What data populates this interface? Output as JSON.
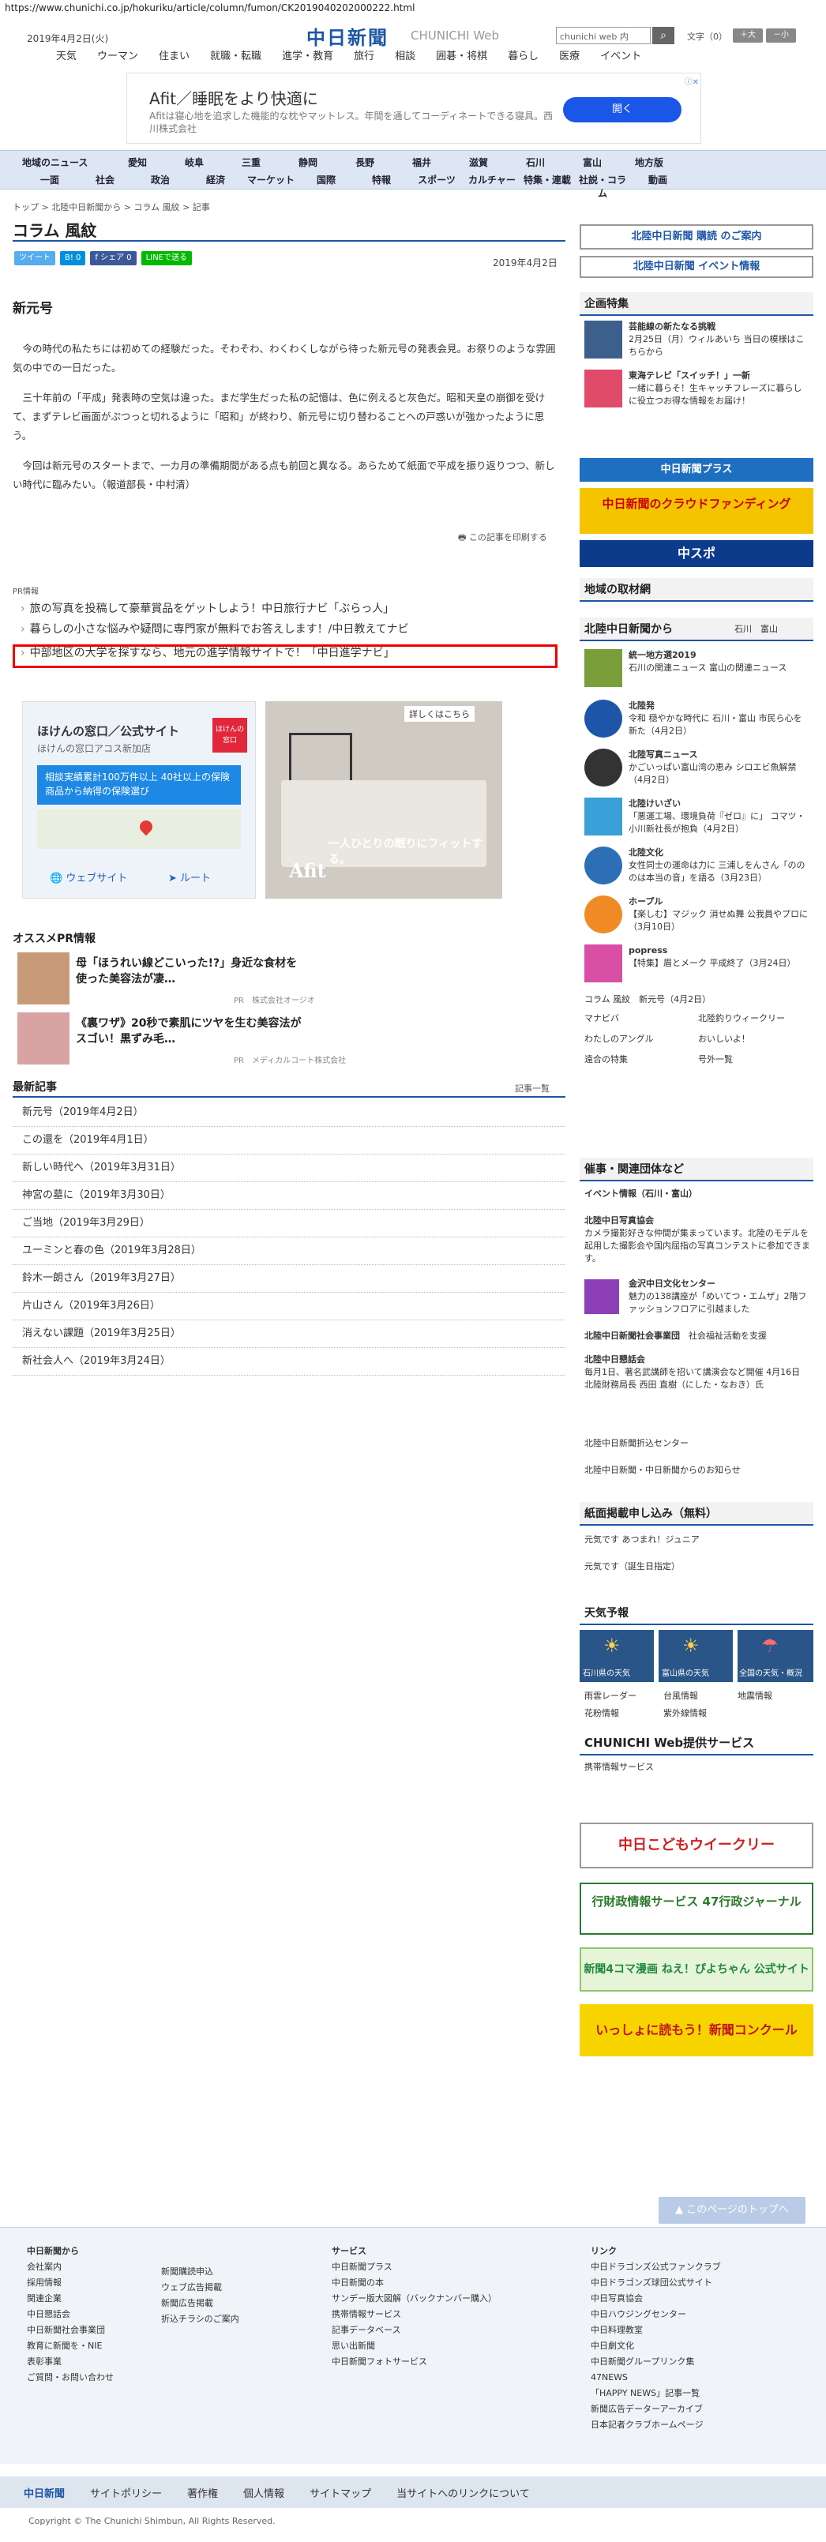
{
  "url": "https://www.chunichi.co.jp/hokuriku/article/column/fumon/CK2019040202000222.html",
  "header": {
    "date": "2019年4月2日(火)",
    "logo": "中日新聞",
    "logo_sub": "CHUNICHI Web",
    "search_placeholder": "chunichi web 内",
    "search_icon": "search-icon",
    "size_label": "文字（0）",
    "size_up": "＋大",
    "size_down": "－小"
  },
  "nav_primary": [
    "天気",
    "ウーマン",
    "住まい",
    "就職・転職",
    "進学・教育",
    "旅行",
    "相談",
    "囲碁・将棋",
    "暮らし",
    "医療",
    "イベント"
  ],
  "ad_top": {
    "title": "Afit／睡眠をより快適に",
    "body": "Afitは寝心地を追求した機能的な枕やマットレス。年間を通してコーディネートできる寝具。西川株式会社",
    "button": "開く"
  },
  "nav_secondary_row1": [
    "地域のニュース",
    "愛知",
    "岐阜",
    "三重",
    "静岡",
    "長野",
    "福井",
    "滋賀",
    "石川",
    "富山",
    "地方版"
  ],
  "nav_secondary_row2": [
    "一面",
    "社会",
    "政治",
    "経済",
    "マーケット",
    "国際",
    "特報",
    "スポーツ",
    "カルチャー",
    "特集・連載",
    "社説・コラム",
    "動画"
  ],
  "breadcrumb": "トップ > 北陸中日新聞から > コラム 風紋 > 記事",
  "column_title": "コラム 風紋",
  "social": {
    "tweet": "ツイート",
    "hatena": "B! 0",
    "facebook": "f シェア 0",
    "line": "LINEで送る"
  },
  "article": {
    "date": "2019年4月2日",
    "headline": "新元号",
    "paragraphs": [
      "今の時代の私たちには初めての経験だった。そわそわ、わくわくしながら待った新元号の発表会見。お祭りのような雰囲気の中での一日だった。",
      "三十年前の「平成」発表時の空気は違った。まだ学生だった私の記憶は、色に例えると灰色だ。昭和天皇の崩御を受けて、まずテレビ画面がぷつっと切れるように「昭和」が終わり、新元号に切り替わることへの戸惑いが強かったように思う。",
      "今回は新元号のスタートまで、一カ月の準備期間がある点も前回と異なる。あらためて紙面で平成を振り返りつつ、新しい時代に臨みたい。（報道部長・中村清）"
    ],
    "print": "この記事を印刷する"
  },
  "pr": {
    "label": "PR情報",
    "items": [
      "旅の写真を投稿して豪華賞品をゲットしよう！中日旅行ナビ「ぶらっ人」",
      "暮らしの小さな悩みや疑問に専門家が無料でお答えします！/中日教えてナビ",
      "中部地区の大学を探すなら、地元の進学情報サイトで！「中日進学ナビ」"
    ]
  },
  "ad_mid_left": {
    "title": "ほけんの窓口／公式サイト",
    "sub": "ほけんの窓口アコス新加店",
    "logo": "ほけんの窓口",
    "blue": "相談実績累計100万件以上 40社以上の保険商品から納得の保険選び",
    "btn1": "ウェブサイト",
    "btn2": "ルート"
  },
  "ad_mid_right": {
    "tag": "詳しくはこちら",
    "copy": "一人ひとりの眠りにフィットする。",
    "logo": "Afit"
  },
  "osusume": {
    "heading": "オススメPR情報",
    "items": [
      {
        "title": "母「ほうれい線どこいった!?」身近な食材を使った美容法が凄…",
        "source": "PR　株式会社オージオ"
      },
      {
        "title": "《裏ワザ》20秒で素肌にツヤを生む美容法がスゴい！黒ずみ毛…",
        "source": "PR　メディカルコート株式会社"
      }
    ]
  },
  "latest": {
    "heading": "最新記事",
    "more": "記事一覧",
    "items": [
      "新元号（2019年4月2日）",
      "この還を（2019年4月1日）",
      "新しい時代へ（2019年3月31日）",
      "神宮の墓に（2019年3月30日）",
      "ご当地（2019年3月29日）",
      "ユーミンと春の色（2019年3月28日）",
      "鈴木一朗さん（2019年3月27日）",
      "片山さん（2019年3月26日）",
      "消えない課題（2019年3月25日）",
      "新社会人へ（2019年3月24日）"
    ]
  },
  "right": {
    "subscribe": "北陸中日新聞 購読 のご案内",
    "event": "北陸中日新聞 イベント情報",
    "kikaku_head": "企画特集",
    "kikaku": [
      {
        "title": "芸能線の新たなる挑戦",
        "text": "2月25日（月）ウィルあいち 当日の模様はこちらから"
      },
      {
        "title": "東海テレビ「スイッチ！」一新",
        "text": "一緒に暮らそ！生キャッチフレーズに暮らしに役立つお得な情報をお届け！"
      }
    ],
    "banner_plus": "中日新聞プラス",
    "banner_cf": "中日新聞のクラウドファンディング",
    "banner_chuspo": "中スポ",
    "chiiki_head": "地域の取材網",
    "hokuriku_head": "北陸中日新聞から",
    "hokuriku_tabs": [
      "石川",
      "富山"
    ],
    "hokuriku_items": [
      {
        "title": "統一地方選2019",
        "text": "石川の関連ニュース 富山の関連ニュース"
      },
      {
        "title": "北陸発",
        "text": "令和 穏やかな時代に 石川・富山 市民ら心を新た（4月2日）"
      },
      {
        "title": "北陸写真ニュース",
        "text": "かごいっぱい富山湾の恵み シロエビ魚解禁（4月2日）"
      },
      {
        "title": "北陸けいざい",
        "text": "「悪運工場、環境負荷『ゼロ』に」 コマツ・小川新社長が抱負（4月2日）"
      },
      {
        "title": "北陸文化",
        "text": "女性同士の運命は力に 三浦しをんさん「のののは本当の音」を語る（3月23日）"
      },
      {
        "title": "ホープル",
        "text": "【楽しむ】マジック 消せぬ舞 公我員やプロに（3月10日）"
      },
      {
        "title": "popress",
        "text": "【特集】眉とメーク 平成終了（3月24日）"
      }
    ],
    "column_links": [
      "コラム 風紋　新元号（4月2日）",
      "マナビバ",
      "北陸釣りウィークリー",
      "わたしのアングル",
      "おいしいよ！",
      "遠合の特集",
      "号外一覧"
    ],
    "kanji_head": "催事・関連団体など",
    "kanji_sub": "イベント情報（石川・富山）",
    "kanji_items": [
      {
        "title": "北陸中日写真協会",
        "text": "カメラ撮影好きな仲間が集まっています。北陸のモデルを起用した撮影会や国内屈指の写真コンテストに参加できます。"
      },
      {
        "title": "金沢中日文化センター",
        "text": "魅力の138講座が「めいてつ・エムザ」2階ファッションフロアに引越ました"
      },
      {
        "title": "北陸中日新聞社会事業団",
        "text": "社会福祉活動を支援"
      },
      {
        "title": "北陸中日懇話会",
        "text": "毎月1日、著名武講師を招いて講演会など開催 4月16日 北陸財務局長 西田 直樹（にした・なおき）氏"
      }
    ],
    "kanji_links": [
      "北陸中日新聞折込センター",
      "北陸中日新聞・中日新聞からのお知らせ"
    ],
    "shimen_head": "紙面掲載申し込み（無料）",
    "shimen_items": [
      "元気です あつまれ！ジュニア",
      "元気です（誕生日指定）"
    ],
    "tenki_head": "天気予報",
    "tenki_items": [
      "石川県の天気",
      "富山県の天気",
      "全国の天気・概況"
    ],
    "tenki_links": [
      "雨雲レーダー",
      "台風情報",
      "地震情報",
      "花粉情報",
      "紫外線情報"
    ],
    "service_head": "CHUNICHI Web提供サービス",
    "service_link": "携帯情報サービス",
    "banner_kodomo": "中日こどもウイークリー",
    "banner_gyosei": "行財政情報サービス 47行政ジャーナル",
    "banner_yonkoma": "新聞4コマ漫画 ねえ！ぴよちゃん 公式サイト",
    "banner_concourse": "いっしょに読もう！新聞コンクール"
  },
  "pagetop": "このページのトップへ",
  "footer": {
    "col1_head": "中日新聞から",
    "col1": [
      "会社案内",
      "採用情報",
      "関連企業",
      "中日懇話会",
      "中日新聞社会事業団",
      "教育に新聞を・NIE",
      "表彰事業",
      "ご質問・お問い合わせ"
    ],
    "col2": [
      "新聞購読申込",
      "ウェブ広告掲載",
      "新聞広告掲載",
      "折込チラシのご案内"
    ],
    "col3_head": "サービス",
    "col3": [
      "中日新聞プラス",
      "中日新聞の本",
      "サンデー版大図解（バックナンバー購入）",
      "携帯情報サービス",
      "記事データベース",
      "思い出新聞",
      "中日新聞フォトサービス"
    ],
    "col4_head": "リンク",
    "col4": [
      "中日ドラゴンズ公式ファンクラブ",
      "中日ドラゴンズ球団公式サイト",
      "中日写真協会",
      "中日ハウジングセンター",
      "中日料理教室",
      "中日劇文化",
      "中日新聞グループリンク集",
      "47NEWS",
      "「HAPPY NEWS」記事一覧",
      "新聞広告データーアーカイブ",
      "日本記者クラブホームページ"
    ],
    "nav": [
      "中日新聞",
      "サイトポリシー",
      "著作権",
      "個人情報",
      "サイトマップ",
      "当サイトへのリンクについて"
    ],
    "copyright": "Copyright © The Chunichi Shimbun, All Rights Reserved."
  },
  "colors": {
    "brand": "#1d56a8",
    "highlight": "#e00000",
    "nav_bg": "#dde7f3"
  }
}
